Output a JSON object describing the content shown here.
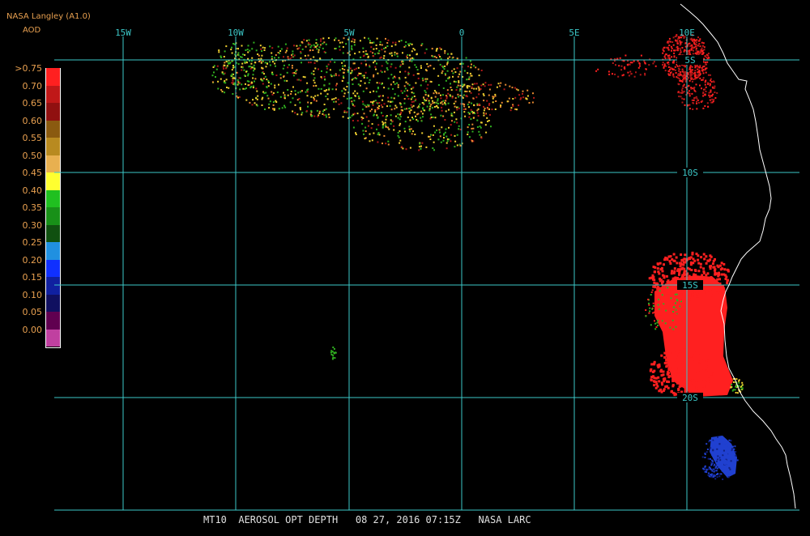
{
  "header": {
    "source": "NASA Langley (A1.0)",
    "product": "AOD"
  },
  "legend": {
    "labels": [
      ">0.75",
      "0.70",
      "0.65",
      "0.60",
      "0.55",
      "0.50",
      "0.45",
      "0.40",
      "0.35",
      "0.30",
      "0.25",
      "0.20",
      "0.15",
      "0.10",
      "0.05",
      "0.00"
    ],
    "colors": [
      "#ff2020",
      "#c01818",
      "#901010",
      "#8a5a10",
      "#b88a20",
      "#e8b050",
      "#ffff30",
      "#20c020",
      "#189018",
      "#105010",
      "#2090e0",
      "#1030ff",
      "#1020a0",
      "#101060",
      "#600050",
      "#c040a0"
    ]
  },
  "grid": {
    "lon_labels": [
      "15W",
      "10W",
      "5W",
      "0",
      "5E",
      "10E"
    ],
    "lat_labels": [
      "5S",
      "10S",
      "15S",
      "20S"
    ],
    "color": "#3cc8c8"
  },
  "footer": {
    "text": "MT10  AEROSOL OPT DEPTH   08 27, 2016 07:15Z   NASA LARC"
  },
  "aod_overlay": {
    "colors": {
      "high": "#ff2020",
      "mid_orange": "#e88a30",
      "yellow": "#f0d030",
      "green": "#30b020",
      "dark_red": "#b01818",
      "blue": "#2040d0",
      "dark_blue": "#102080"
    }
  },
  "coastline_color": "#ffffff"
}
